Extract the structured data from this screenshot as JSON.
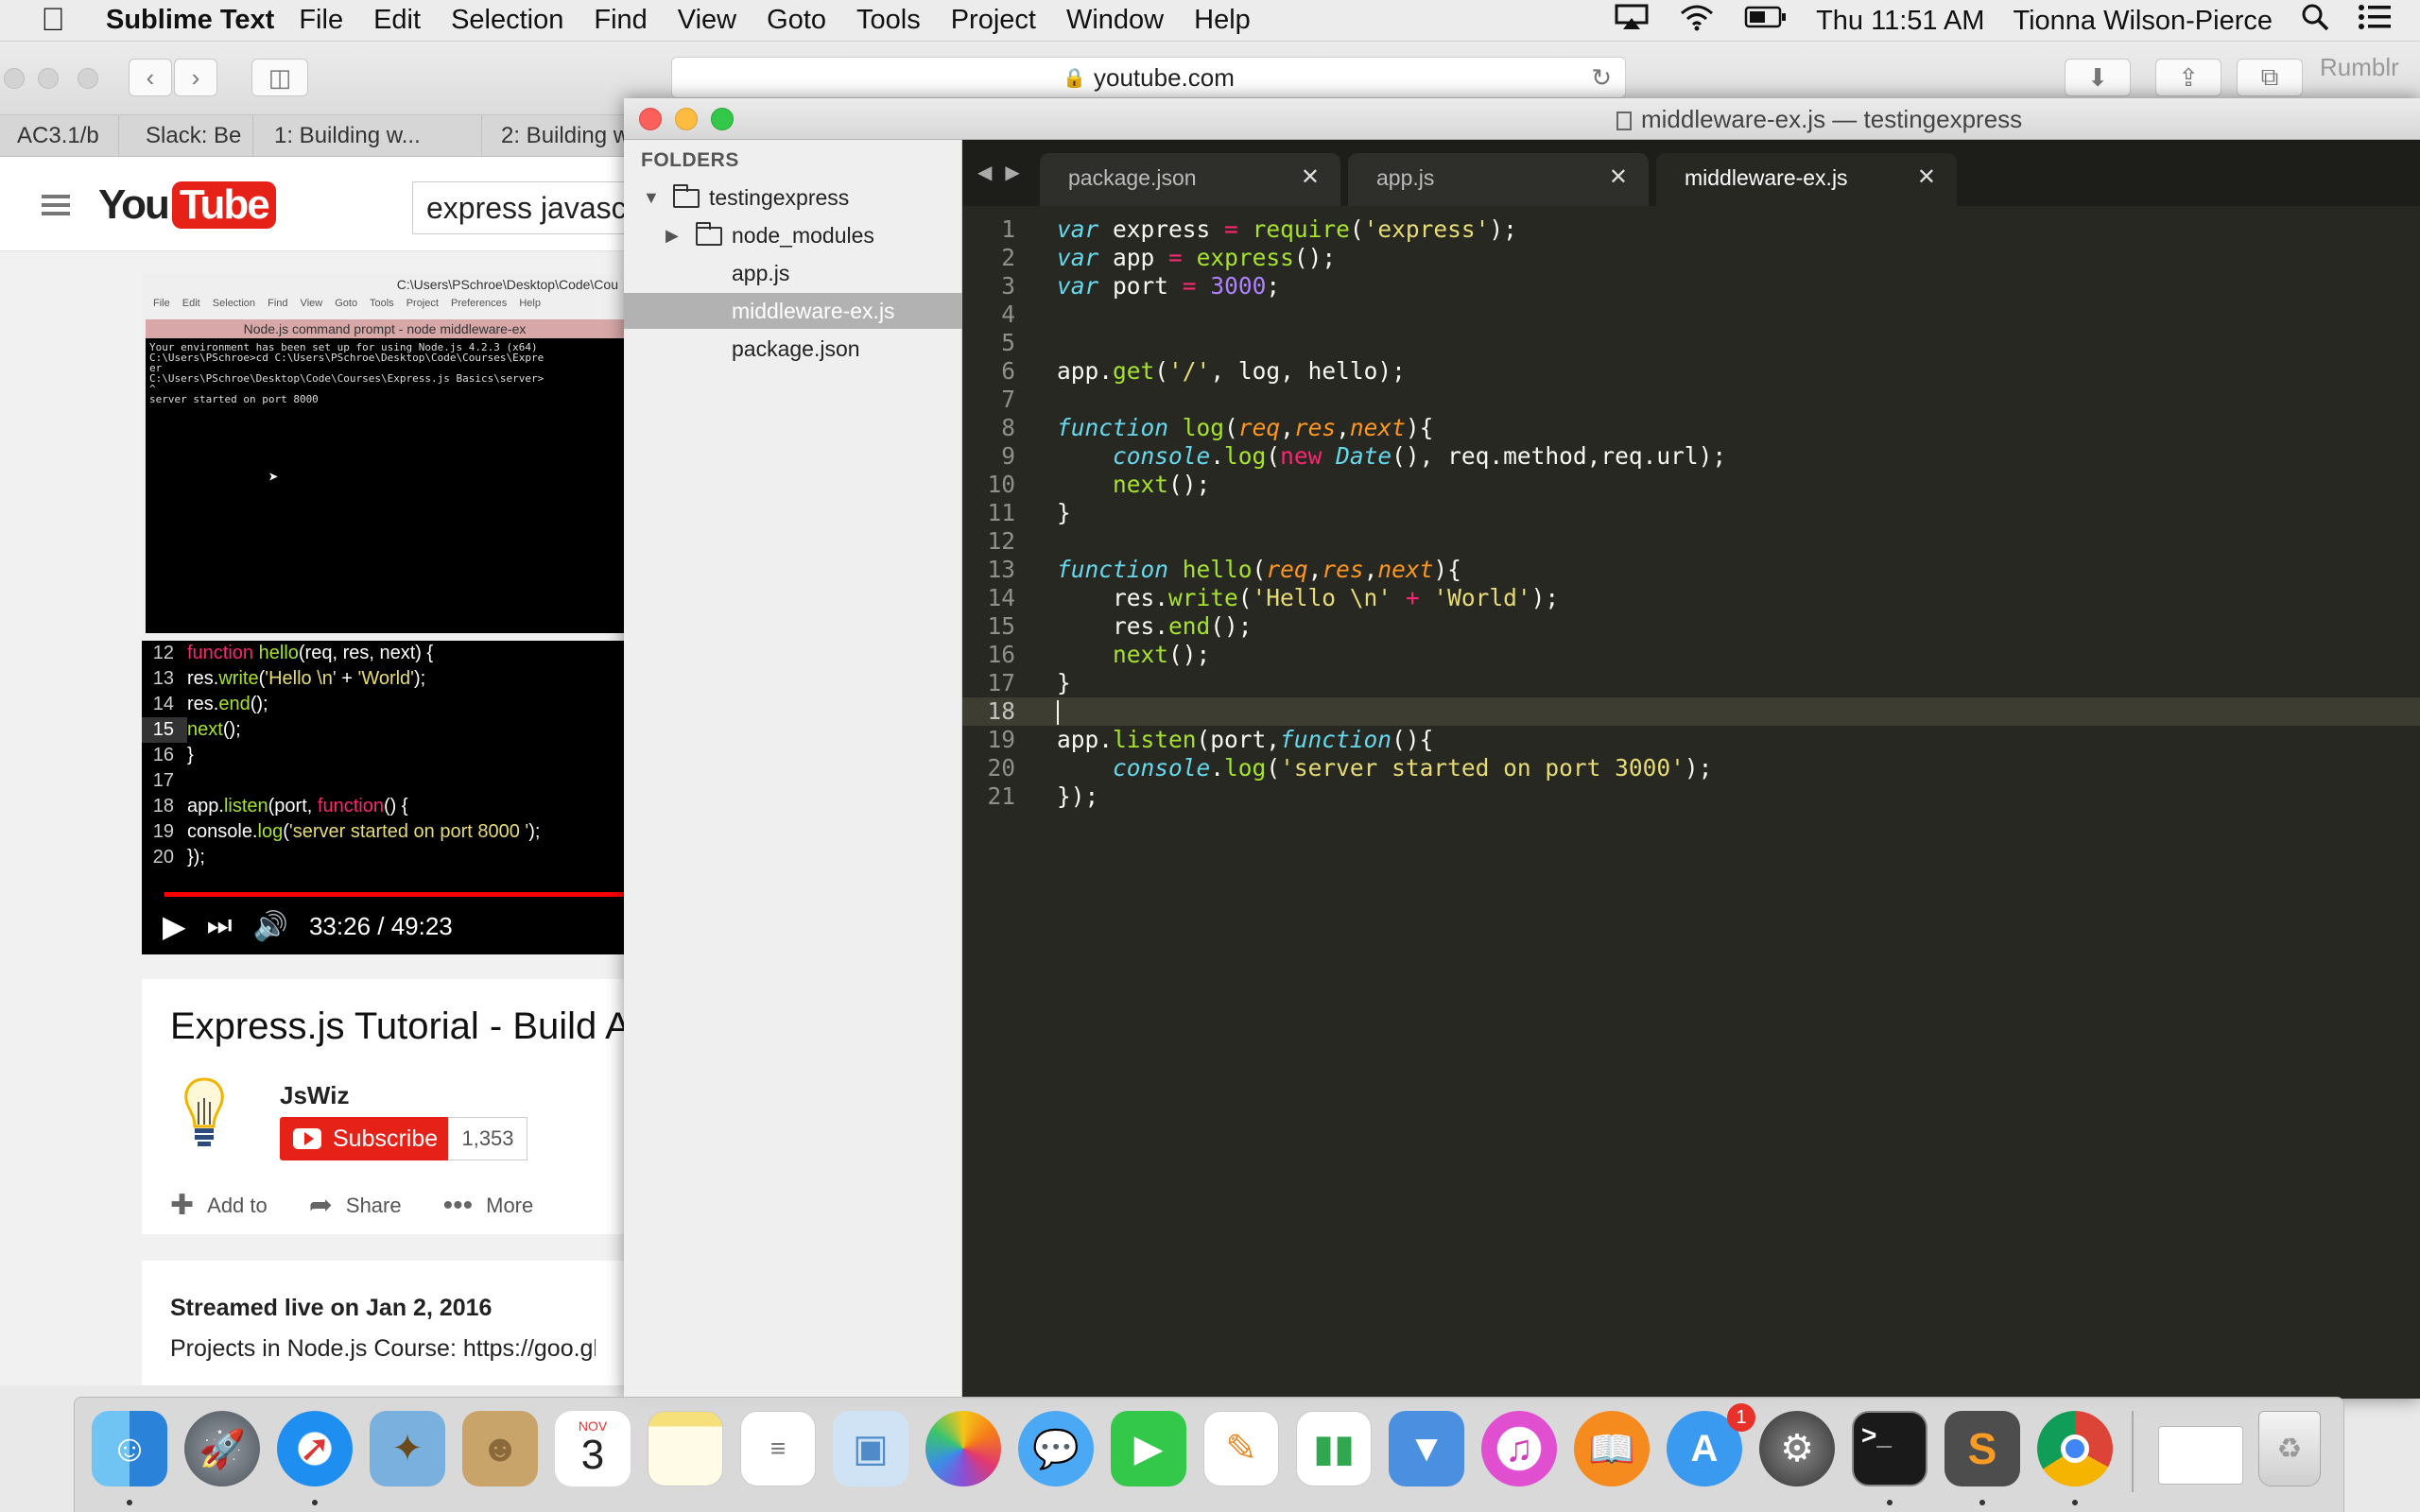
{
  "menubar": {
    "app_name": "Sublime Text",
    "menus": [
      "File",
      "Edit",
      "Selection",
      "Find",
      "View",
      "Goto",
      "Tools",
      "Project",
      "Window",
      "Help"
    ],
    "clock": "Thu 11:51 AM",
    "user": "Tionna Wilson-Pierce"
  },
  "safari": {
    "url": "youtube.com",
    "tabs": [
      "AC3.1/b",
      "Slack: Be",
      "1: Building w...",
      "2: Building w"
    ],
    "right_tab": "Rumblr"
  },
  "youtube": {
    "logo_you": "You",
    "logo_tube": "Tube",
    "search_value": "express javasc",
    "video": {
      "window_title": "C:\\Users\\PSchroe\\Desktop\\Code\\Cou",
      "menu": "File Edit Selection Find View Goto Tools Project Preferences Help",
      "cmd_title": "Node.js command prompt - node  middleware-ex",
      "cmd_lines": [
        "Your environment has been set up for using Node.js 4.2.3 (x64)",
        "C:\\Users\\PSchroe>cd C:\\Users\\PSchroe\\Desktop\\Code\\Courses\\Expre",
        "er",
        "",
        "C:\\Users\\PSchroe\\Desktop\\Code\\Courses\\Express.js_Basics\\server>",
        "^",
        "server started on port 8000"
      ],
      "code_lines": [
        {
          "n": "12",
          "t": "function hello(req, res, next) {"
        },
        {
          "n": "13",
          "t": "  res.write('Hello \\n' + 'World');"
        },
        {
          "n": "14",
          "t": "  res.end();"
        },
        {
          "n": "15",
          "t": "  next();"
        },
        {
          "n": "16",
          "t": "}"
        },
        {
          "n": "17",
          "t": ""
        },
        {
          "n": "18",
          "t": "app.listen(port, function() {"
        },
        {
          "n": "19",
          "t": "  console.log('server started on port 8000 ');"
        },
        {
          "n": "20",
          "t": "});"
        }
      ],
      "active_line": "15",
      "time": "33:26 / 49:23",
      "progress_fraction": 0.677
    },
    "title": "Express.js Tutorial - Build A",
    "channel": "JsWiz",
    "subscribe": "Subscribe",
    "sub_count": "1,353",
    "actions": {
      "add": "Add to",
      "share": "Share",
      "more": "More"
    },
    "streamed": "Streamed live on Jan 2, 2016",
    "desc_line": "Projects in Node.js Course: https://goo.gl/"
  },
  "sublime": {
    "window_title": "middleware-ex.js — testingexpress",
    "folders_header": "FOLDERS",
    "tree": {
      "root": "testingexpress",
      "node_modules": "node_modules",
      "files": [
        "app.js",
        "middleware-ex.js",
        "package.json"
      ]
    },
    "tabs": [
      "package.json",
      "app.js",
      "middleware-ex.js"
    ],
    "active_tab": "middleware-ex.js",
    "cursor_line": 18,
    "line_numbers": [
      "1",
      "2",
      "3",
      "4",
      "5",
      "6",
      "7",
      "8",
      "9",
      "10",
      "11",
      "12",
      "13",
      "14",
      "15",
      "16",
      "17",
      "18",
      "19",
      "20",
      "21"
    ],
    "code_lines": [
      "var express = require('express');",
      "var app = express();",
      "var port = 3000;",
      "",
      "",
      "app.get('/', log, hello);",
      "",
      "function log(req,res,next){",
      "    console.log(new Date(), req.method,req.url);",
      "    next();",
      "}",
      "",
      "function hello(req,res,next){",
      "    res.write('Hello \\n' + 'World');",
      "    res.end();",
      "    next();",
      "}",
      "",
      "app.listen(port,function(){",
      "    console.log('server started on port 3000');",
      "});"
    ],
    "colors": {
      "background": "#272822",
      "keyword": "#66d9ef",
      "function": "#a6e22e",
      "string": "#e6db74",
      "number": "#ae81ff",
      "operator": "#f92672",
      "param": "#fd971f"
    }
  },
  "dock": {
    "calendar_month": "NOV",
    "calendar_day": "3",
    "app_store_badge": "1",
    "apps": [
      "finder-icon",
      "launchpad-icon",
      "safari-icon",
      "mail-icon",
      "contacts-icon",
      "calendar-icon",
      "notes-icon",
      "reminders-icon",
      "preview-icon",
      "photos-icon",
      "messages-icon",
      "facetime-icon",
      "pages-icon",
      "numbers-icon",
      "keynote-icon",
      "itunes-icon",
      "ibooks-icon",
      "app-store-icon",
      "system-preferences-icon",
      "terminal-icon",
      "sublime-text-icon",
      "chrome-icon"
    ]
  }
}
